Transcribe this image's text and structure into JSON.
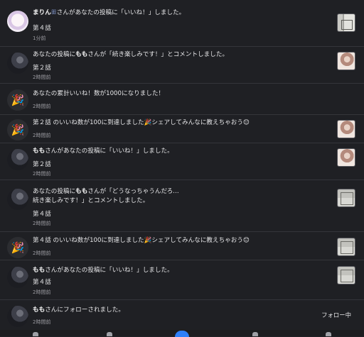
{
  "notifications": [
    {
      "actor": "まりん",
      "actor_suffix": "",
      "message": "さんがあなたの投稿に「いいね！」しました。",
      "line2": "",
      "episode": "第４話",
      "time": "1分前",
      "avatar": "girl-avatar",
      "thumb": "room"
    },
    {
      "prefix": "あなたの投稿に",
      "actor": "もも",
      "message": "さんが「続き楽しみです！」とコメントしました。",
      "line2": "",
      "episode": "第２話",
      "time": "2時間前",
      "avatar": "user-avatar",
      "thumb": "girl"
    },
    {
      "prefix": "",
      "actor": "",
      "message": "あなたの累計いいね！数が1000になりました！",
      "line2": "",
      "episode": "",
      "time": "2時間前",
      "avatar": "party-icon",
      "thumb": ""
    },
    {
      "prefix": "",
      "actor": "",
      "message": "第２話 のいいね数が100に到達しました🎉シェアしてみんなに教えちゃおう😊",
      "line2": "",
      "episode": "",
      "time": "2時間前",
      "avatar": "party-icon",
      "thumb": "girl"
    },
    {
      "prefix": "",
      "actor": "もも",
      "message": "さんがあなたの投稿に「いいね！」しました。",
      "line2": "",
      "episode": "第２話",
      "time": "2時間前",
      "avatar": "user-avatar",
      "thumb": "girl"
    },
    {
      "prefix": "あなたの投稿に",
      "actor": "もも",
      "message": "さんが「どうなっちゃうんだろ…",
      "line2": "続き楽しみです！」とコメントしました。",
      "episode": "第４話",
      "time": "2時間前",
      "avatar": "user-avatar",
      "thumb": "room"
    },
    {
      "prefix": "",
      "actor": "",
      "message": "第４話 のいいね数が100に到達しました🎉シェアしてみんなに教えちゃおう😊",
      "line2": "",
      "episode": "",
      "time": "2時間前",
      "avatar": "party-icon",
      "thumb": "room"
    },
    {
      "prefix": "",
      "actor": "もも",
      "message": "さんがあなたの投稿に「いいね！」しました。",
      "line2": "",
      "episode": "第４話",
      "time": "2時間前",
      "avatar": "user-avatar",
      "thumb": "room"
    },
    {
      "prefix": "",
      "actor": "もも",
      "message": "さんにフォローされました。",
      "line2": "",
      "episode": "",
      "time": "2時間前",
      "avatar": "user-avatar",
      "thumb": ""
    }
  ],
  "follow_status": "フォロー中",
  "badge_icon": "sparkle-icon",
  "party_icon": "🎉"
}
